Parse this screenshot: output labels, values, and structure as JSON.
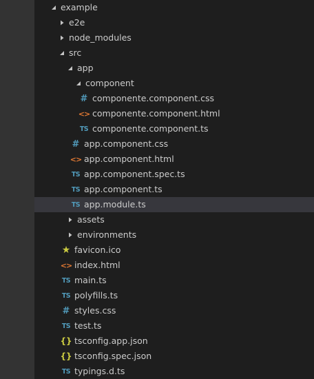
{
  "explorer": {
    "example": {
      "label": "example"
    },
    "e2e": {
      "label": "e2e"
    },
    "node_modules": {
      "label": "node_modules"
    },
    "src": {
      "label": "src"
    },
    "app": {
      "label": "app"
    },
    "component": {
      "label": "component"
    },
    "comp_css": {
      "label": "componente.component.css"
    },
    "comp_html": {
      "label": "componente.component.html"
    },
    "comp_ts": {
      "label": "componente.component.ts"
    },
    "app_css": {
      "label": "app.component.css"
    },
    "app_html": {
      "label": "app.component.html"
    },
    "app_spec": {
      "label": "app.component.spec.ts"
    },
    "app_ts": {
      "label": "app.component.ts"
    },
    "app_module": {
      "label": "app.module.ts"
    },
    "assets": {
      "label": "assets"
    },
    "environments": {
      "label": "environments"
    },
    "favicon": {
      "label": "favicon.ico"
    },
    "index": {
      "label": "index.html"
    },
    "main": {
      "label": "main.ts"
    },
    "polyfills": {
      "label": "polyfills.ts"
    },
    "styles": {
      "label": "styles.css"
    },
    "test": {
      "label": "test.ts"
    },
    "tsconfig_app": {
      "label": "tsconfig.app.json"
    },
    "tsconfig_spec": {
      "label": "tsconfig.spec.json"
    },
    "typings": {
      "label": "typings.d.ts"
    }
  },
  "glyphs": {
    "ts": "TS",
    "css": "#",
    "html": "<>",
    "json": "{}",
    "star": "★"
  },
  "colors": {
    "background": "#1e1e1e",
    "gutter": "#333333",
    "selected_row": "#37373d",
    "text": "#cccccc",
    "ts_icon": "#519aba",
    "css_icon": "#519aba",
    "html_icon": "#e37933",
    "json_icon": "#cbcb41",
    "favicon_icon": "#cbcb41"
  }
}
